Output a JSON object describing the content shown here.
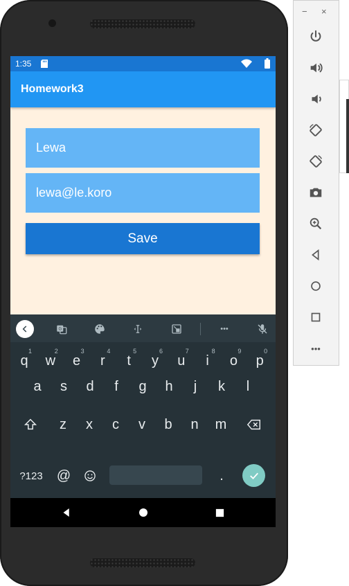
{
  "status_bar": {
    "time": "1:35",
    "sd_icon": "sd-card-icon",
    "wifi_icon": "wifi-icon",
    "battery_icon": "battery-icon"
  },
  "app": {
    "title": "Homework3"
  },
  "form": {
    "name_value": "Lewa",
    "email_value": "lewa@le.koro",
    "save_label": "Save"
  },
  "keyboard": {
    "toolbar_icons": [
      "back-icon",
      "translate-icon",
      "palette-icon",
      "cursor-icon",
      "screen-icon",
      "more-icon",
      "mic-off-icon"
    ],
    "more_label": "•••",
    "row1": [
      {
        "k": "q",
        "h": "1"
      },
      {
        "k": "w",
        "h": "2"
      },
      {
        "k": "e",
        "h": "3"
      },
      {
        "k": "r",
        "h": "4"
      },
      {
        "k": "t",
        "h": "5"
      },
      {
        "k": "y",
        "h": "6"
      },
      {
        "k": "u",
        "h": "7"
      },
      {
        "k": "i",
        "h": "8"
      },
      {
        "k": "o",
        "h": "9"
      },
      {
        "k": "p",
        "h": "0"
      }
    ],
    "row2": [
      "a",
      "s",
      "d",
      "f",
      "g",
      "h",
      "j",
      "k",
      "l"
    ],
    "row3": [
      "z",
      "x",
      "c",
      "v",
      "b",
      "n",
      "m"
    ],
    "symbols_label": "?123",
    "at_label": "@",
    "period_label": "."
  },
  "emulator_panel": {
    "minimize": "−",
    "close": "×",
    "more": "•••",
    "buttons": [
      "power-icon",
      "volume-up-icon",
      "volume-down-icon",
      "rotate-left-icon",
      "rotate-right-icon",
      "camera-icon",
      "zoom-icon",
      "back-icon",
      "home-icon",
      "overview-icon",
      "more-icon"
    ]
  },
  "colors": {
    "status_bar": "#1976d2",
    "toolbar": "#2196f3",
    "field": "#64b5f6",
    "button": "#1976d2",
    "background": "#fff1e0",
    "keyboard": "#263238",
    "enter_key": "#80cbc4"
  }
}
